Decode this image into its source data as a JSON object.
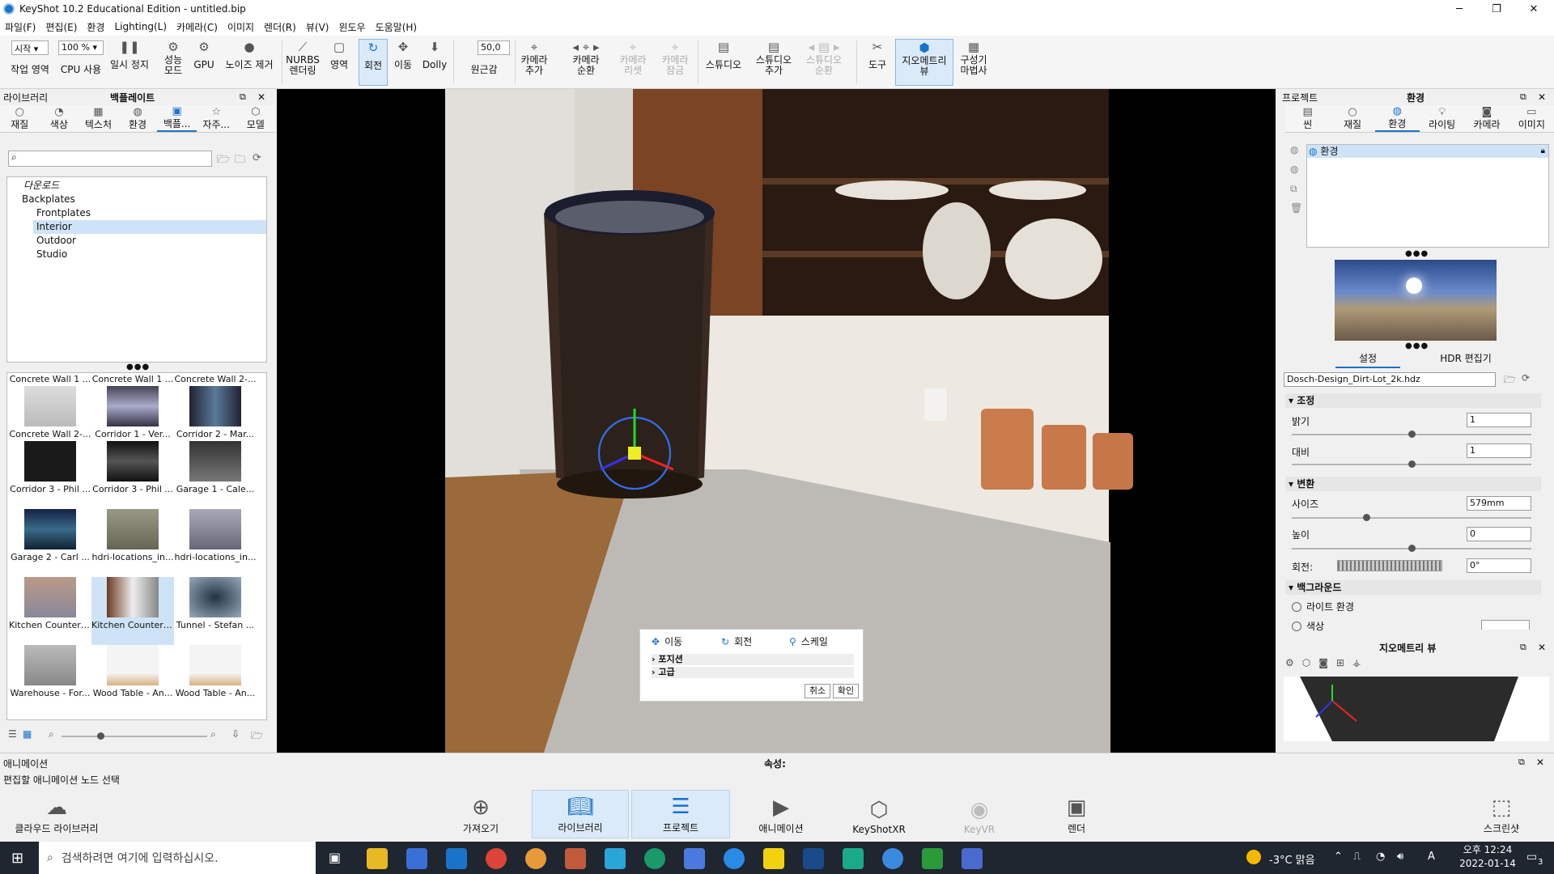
{
  "window": {
    "title": "KeyShot 10.2 Educational Edition  - untitled.bip",
    "minimize": "─",
    "maximize": "❐",
    "close": "✕"
  },
  "menu": [
    "파일(F)",
    "편집(E)",
    "환경",
    "Lighting(L)",
    "카메라(C)",
    "이미지",
    "렌더(R)",
    "뷰(V)",
    "윈도우",
    "도움말(H)"
  ],
  "toolbar": {
    "mode_combo": "시작",
    "zoom_combo": "100 %",
    "fov_value": "50,0",
    "buttons": [
      {
        "label": "작업 영역",
        "icon": "workspace"
      },
      {
        "label": "CPU 사용",
        "icon": "cpu"
      },
      {
        "label": "일시 정지",
        "icon": "pause"
      },
      {
        "label": "성능\n모드",
        "icon": "performance"
      },
      {
        "label": "GPU",
        "icon": "gpu"
      },
      {
        "label": "노이즈 제거",
        "icon": "denoise"
      },
      {
        "label": "NURBS\n렌더링",
        "icon": "nurbs"
      },
      {
        "label": "영역",
        "icon": "region"
      },
      {
        "label": "회전",
        "icon": "rotate"
      },
      {
        "label": "이동",
        "icon": "move"
      },
      {
        "label": "Dolly",
        "icon": "dolly"
      },
      {
        "label": "원근감",
        "icon": "perspective"
      },
      {
        "label": "카메라\n추가",
        "icon": "camera-add"
      },
      {
        "label": "카메라\n순환",
        "icon": "camera-cycle"
      },
      {
        "label": "카메라\n리셋",
        "icon": "camera-reset"
      },
      {
        "label": "카메라\n잠금",
        "icon": "camera-lock"
      },
      {
        "label": "스튜디오",
        "icon": "studio"
      },
      {
        "label": "스튜디오\n추가",
        "icon": "studio-add"
      },
      {
        "label": "스튜디오\n순환",
        "icon": "studio-cycle"
      },
      {
        "label": "도구",
        "icon": "tools"
      },
      {
        "label": "지오메트리\n뷰",
        "icon": "geometry-view"
      },
      {
        "label": "구성기\n마법사",
        "icon": "configurator"
      }
    ]
  },
  "library": {
    "header": "라이브러리",
    "title": "백플레이트",
    "tabs": [
      "재질",
      "색상",
      "텍스처",
      "환경",
      "백플...",
      "자주...",
      "모델"
    ],
    "tree": [
      "다운로드",
      "Backplates",
      "Frontplates",
      "Interior",
      "Outdoor",
      "Studio"
    ],
    "thumbs": [
      {
        "top": "Concrete Wall 1 ...",
        "bottom": "Concrete Wall 2-..."
      },
      {
        "top": "Concrete Wall 1 ...",
        "bottom": "Corridor 1 - Ver..."
      },
      {
        "top": "Concrete Wall 2-...",
        "bottom": "Corridor 2 - Mar..."
      },
      {
        "bottom": "Corridor 3 - Phil ..."
      },
      {
        "bottom": "Corridor 3 - Phil ..."
      },
      {
        "bottom": "Garage 1 - Cale..."
      },
      {
        "bottom": "Garage 2 - Carl ..."
      },
      {
        "bottom": "hdri-locations_in..."
      },
      {
        "bottom": "hdri-locations_in..."
      },
      {
        "bottom": "Kitchen Counter ..."
      },
      {
        "bottom": "Kitchen Counter ..."
      },
      {
        "bottom": "Tunnel - Stefan ..."
      },
      {
        "bottom": "Warehouse - For..."
      },
      {
        "bottom": "Wood Table - An..."
      },
      {
        "bottom": "Wood Table - An..."
      }
    ]
  },
  "transform_popup": {
    "move": "이동",
    "rotate": "회전",
    "scale": "스케일",
    "pivot": "포지션",
    "advanced": "고급",
    "cancel": "취소",
    "ok": "확인"
  },
  "project": {
    "header": "프로젝트",
    "title": "환경",
    "tabs": [
      "씬",
      "재질",
      "환경",
      "라이팅",
      "카메라",
      "이미지"
    ],
    "env_item": "환경",
    "subtabs": [
      "설정",
      "HDR 편집기"
    ],
    "hdr_file": "Dosch-Design_Dirt-Lot_2k.hdz",
    "sections": {
      "adjust": "조정",
      "transform": "변환",
      "background": "백그라운드"
    },
    "brightness": {
      "label": "밝기",
      "value": "1",
      "level": 0.5
    },
    "contrast": {
      "label": "대비",
      "value": "1",
      "level": 0.5
    },
    "size": {
      "label": "사이즈",
      "value": "579mm",
      "level": 0.31
    },
    "height": {
      "label": "높이",
      "value": "0",
      "level": 0.5
    },
    "rotation": {
      "label": "회전:",
      "value": "0°"
    },
    "bg_options": [
      "라이트 환경",
      "색상"
    ]
  },
  "geometry_view": {
    "title": "지오메트리 뷰"
  },
  "animation": {
    "header": "애니메이션",
    "props": "속성:",
    "hint": "편집할 애니메이션 노드 선택"
  },
  "bottom": [
    {
      "label": "클라우드 라이브러리",
      "icon": "cloud"
    },
    {
      "label": "가져오기",
      "icon": "import"
    },
    {
      "label": "라이브러리",
      "icon": "library"
    },
    {
      "label": "프로젝트",
      "icon": "project"
    },
    {
      "label": "애니메이션",
      "icon": "animation"
    },
    {
      "label": "KeyShotXR",
      "icon": "xr"
    },
    {
      "label": "KeyVR",
      "icon": "vr"
    },
    {
      "label": "렌더",
      "icon": "render"
    },
    {
      "label": "스크린샷",
      "icon": "screenshot"
    }
  ],
  "taskbar": {
    "search": "검색하려면 여기에 입력하십시오.",
    "weather": "-3°C 맑음",
    "ime": "A",
    "time": "오후 12:24",
    "date": "2022-01-14",
    "notif": "3"
  },
  "colors": {
    "accent": "#1a73c9"
  }
}
